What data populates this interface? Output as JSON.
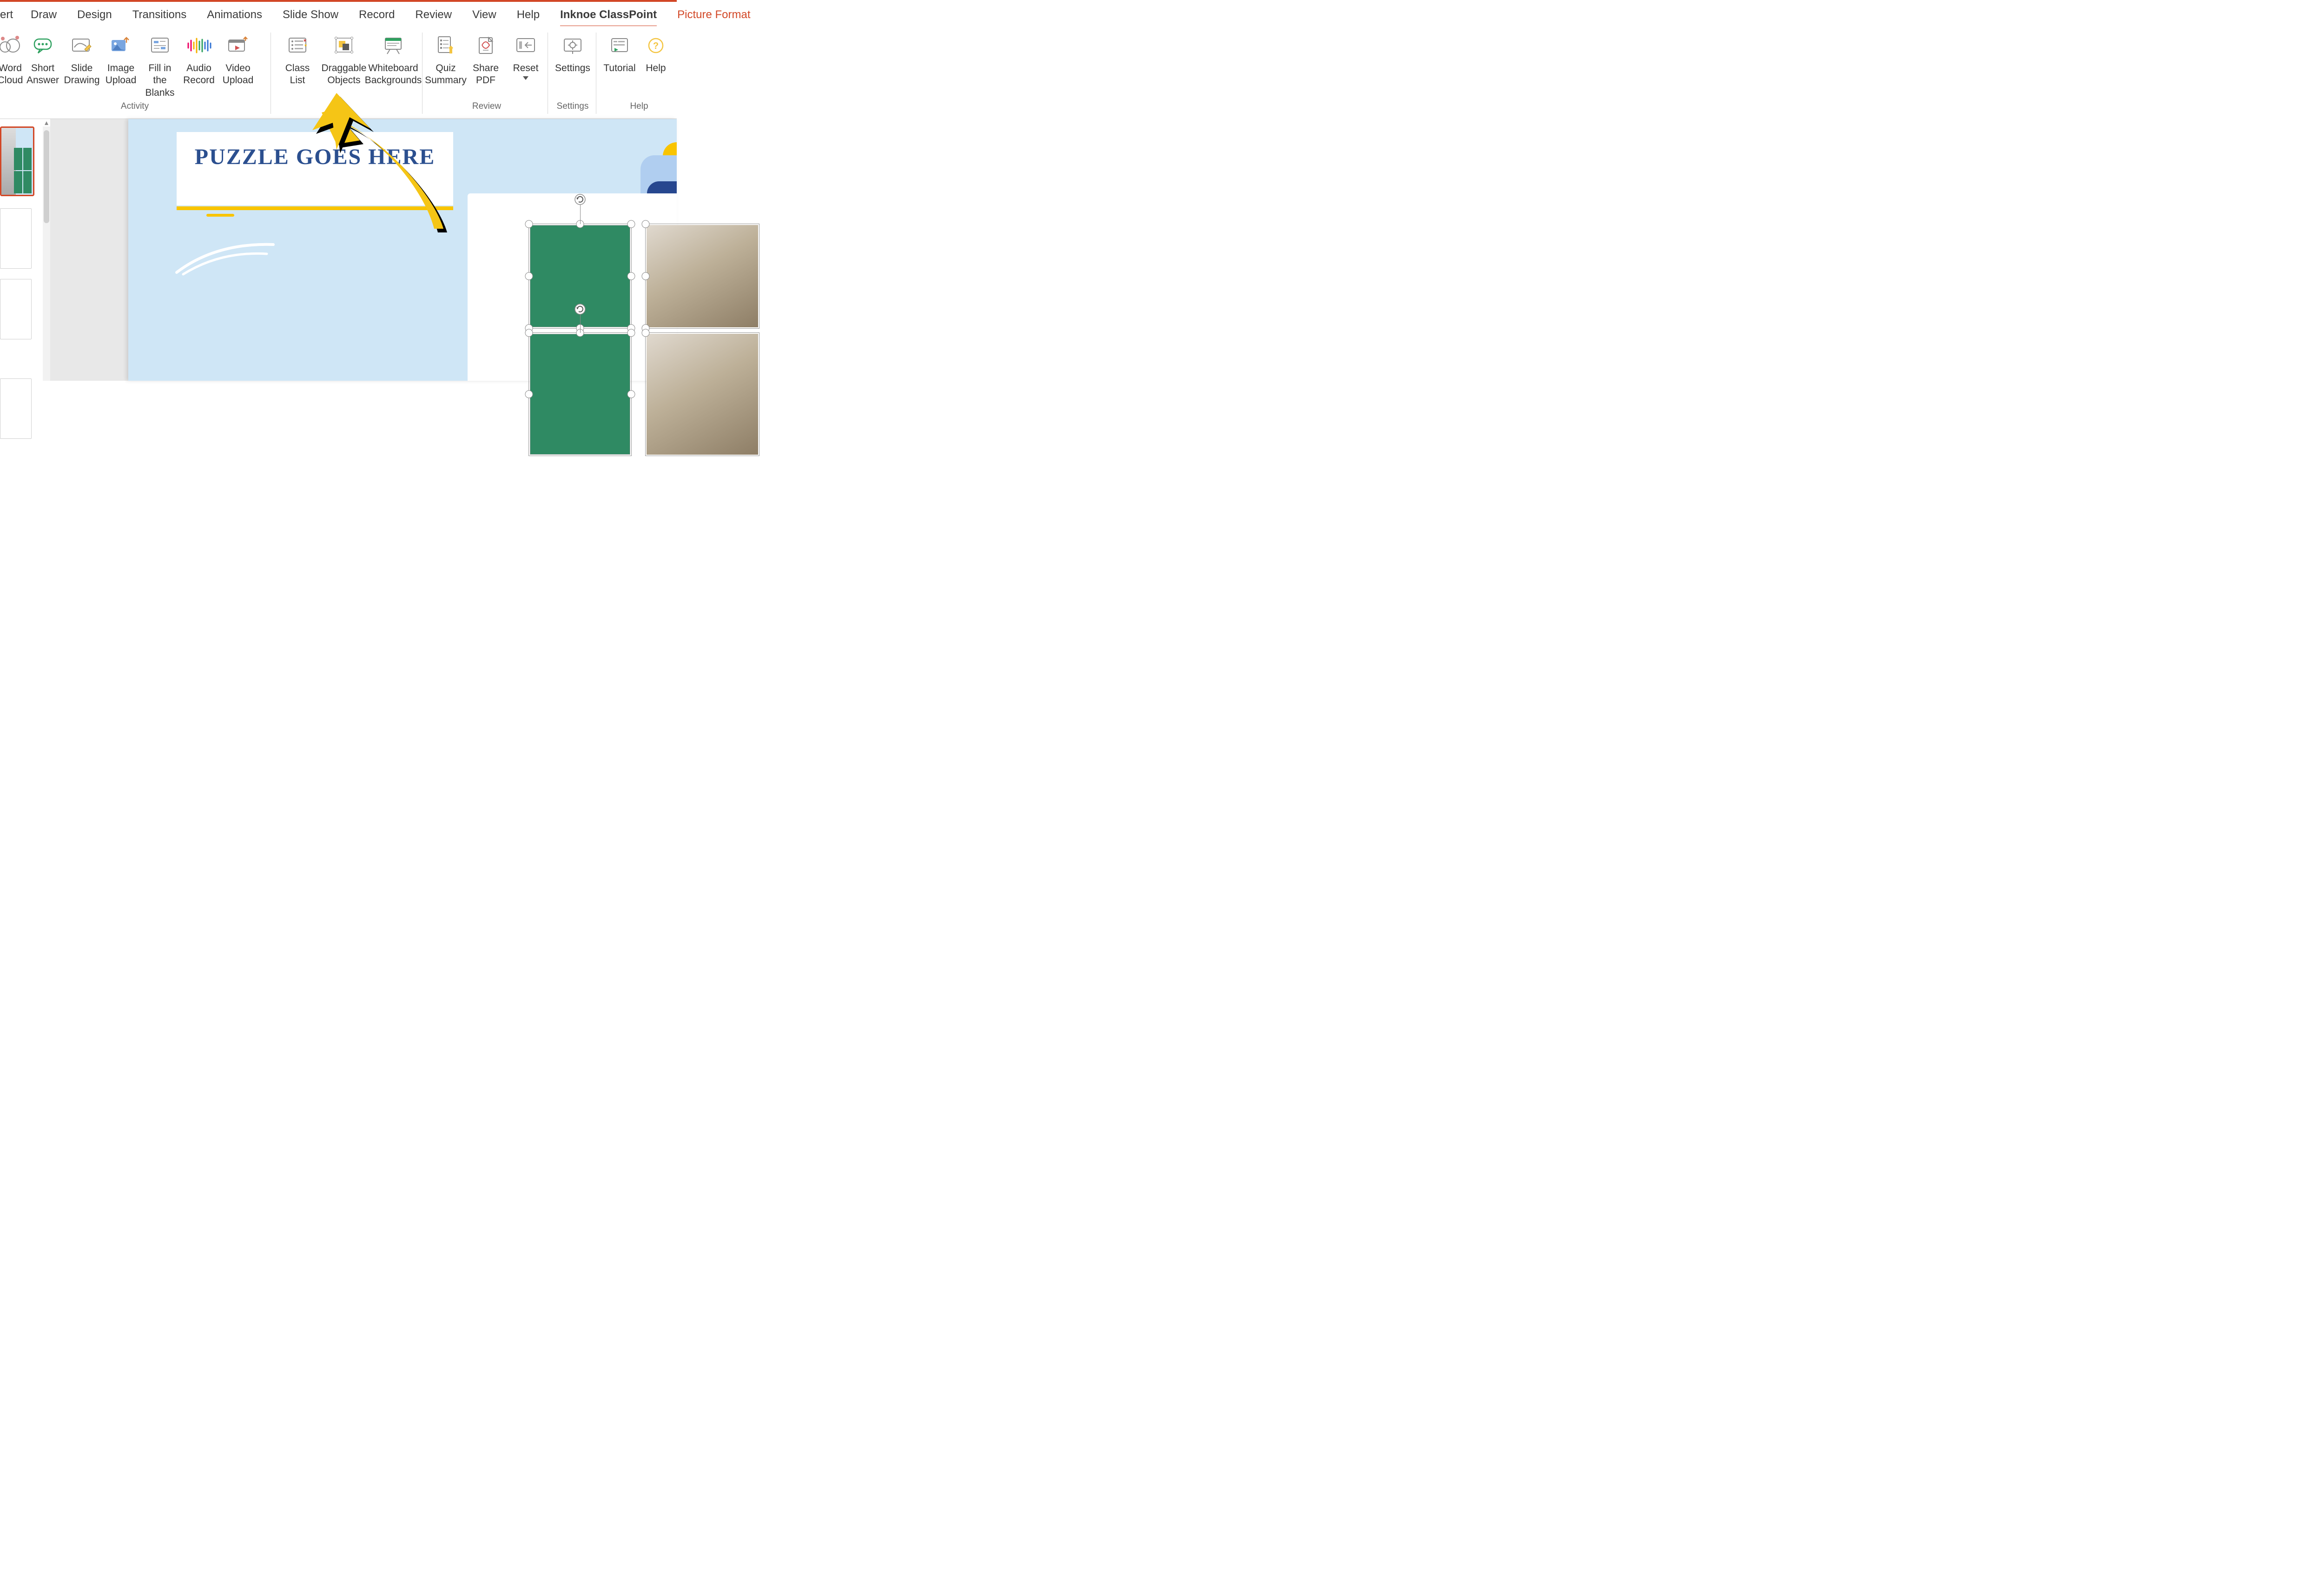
{
  "menu": {
    "tabs": [
      "ert",
      "Draw",
      "Design",
      "Transitions",
      "Animations",
      "Slide Show",
      "Record",
      "Review",
      "View",
      "Help",
      "Inknoe ClassPoint",
      "Picture Format"
    ],
    "active_tab": "Inknoe ClassPoint",
    "highlighted_tab": "Picture Format"
  },
  "ribbon": {
    "groups": {
      "activity": {
        "label": "Activity",
        "buttons": [
          {
            "id": "word-cloud",
            "label": "Word\nCloud"
          },
          {
            "id": "short-answer",
            "label": "Short\nAnswer"
          },
          {
            "id": "slide-drawing",
            "label": "Slide\nDrawing"
          },
          {
            "id": "image-upload",
            "label": "Image\nUpload"
          },
          {
            "id": "fill-blanks",
            "label": "Fill in the\nBlanks"
          },
          {
            "id": "audio-record",
            "label": "Audio\nRecord"
          },
          {
            "id": "video-upload",
            "label": "Video\nUpload"
          }
        ]
      },
      "slidetools": {
        "label": "",
        "buttons": [
          {
            "id": "class-list",
            "label": "Class\nList"
          },
          {
            "id": "draggable-objects",
            "label": "Draggable\nObjects"
          },
          {
            "id": "whiteboard-bg",
            "label": "Whiteboard\nBackgrounds"
          }
        ]
      },
      "review": {
        "label": "Review",
        "buttons": [
          {
            "id": "quiz-summary",
            "label": "Quiz\nSummary"
          },
          {
            "id": "share-pdf",
            "label": "Share\nPDF"
          },
          {
            "id": "reset",
            "label": "Reset",
            "has_dropdown": true
          }
        ]
      },
      "settings": {
        "label": "Settings",
        "buttons": [
          {
            "id": "settings",
            "label": "Settings"
          }
        ]
      },
      "help": {
        "label": "Help",
        "buttons": [
          {
            "id": "tutorial",
            "label": "Tutorial"
          },
          {
            "id": "help",
            "label": "Help"
          }
        ]
      }
    }
  },
  "slide": {
    "title": "PUZZLE   GOES\nHERE"
  },
  "thumbs": {
    "count": 4,
    "active": 1
  },
  "arrow_target": "Draggable Objects"
}
